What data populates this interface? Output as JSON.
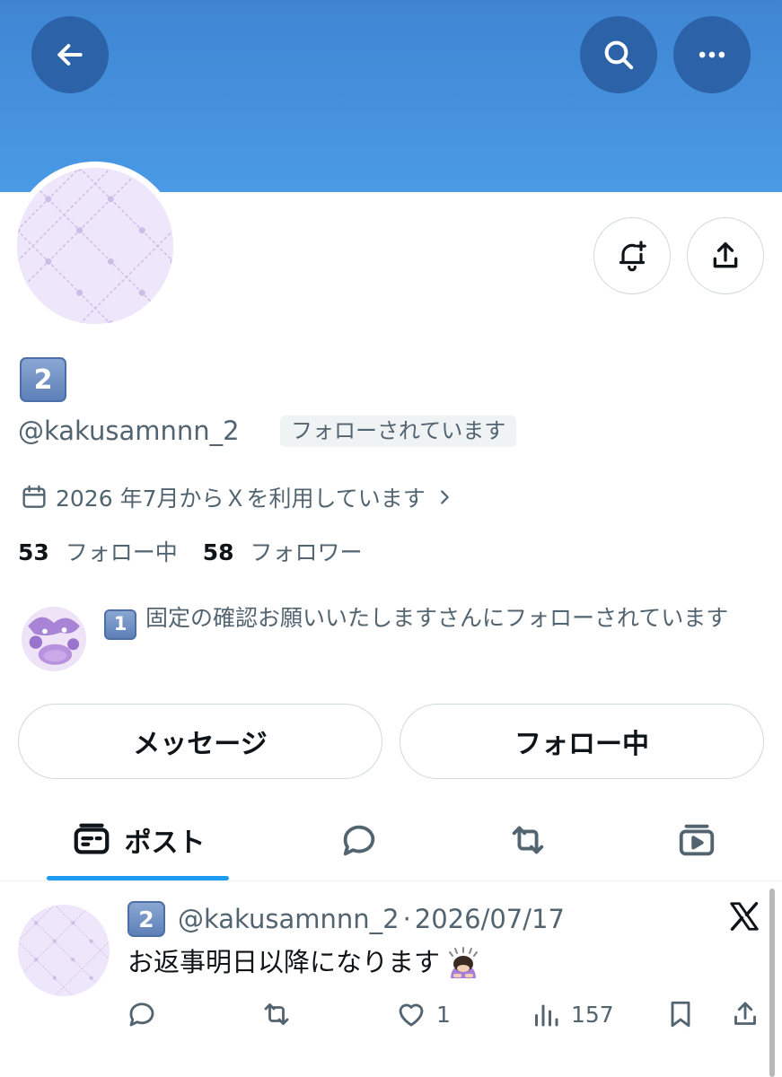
{
  "profile": {
    "display_name": "2",
    "handle": "@kakusamnnn_2",
    "follows_you": "フォローされています",
    "joined": "2026 年7月からＸを利用しています",
    "following_count": "53",
    "following_label": "フォロー中",
    "followers_count": "58",
    "followers_label": "フォロワー"
  },
  "followed_by": {
    "badge": "1",
    "text": "固定の確認お願いいたしますさんにフォローされています"
  },
  "buttons": {
    "message": "メッセージ",
    "following": "フォロー中"
  },
  "tabs": {
    "posts": "ポスト"
  },
  "post": {
    "badge": "2",
    "handle": "@kakusamnnn_2",
    "separator": "·",
    "date": "2026/07/17",
    "text": "お返事明日以降になります",
    "likes": "1",
    "views": "157"
  },
  "colors": {
    "banner": "#4a9ae6",
    "header_button": "#2c62a8",
    "accent": "#1d9bf0",
    "secondary_text": "#536471"
  },
  "icons": [
    "back-arrow-icon",
    "search-icon",
    "more-icon",
    "bell-plus-icon",
    "share-icon",
    "calendar-icon",
    "chevron-right-icon",
    "posts-tab-icon",
    "replies-tab-icon",
    "reposts-tab-icon",
    "media-tab-icon",
    "reply-icon",
    "repost-icon",
    "like-icon",
    "views-icon",
    "bookmark-icon",
    "x-logo-icon"
  ]
}
